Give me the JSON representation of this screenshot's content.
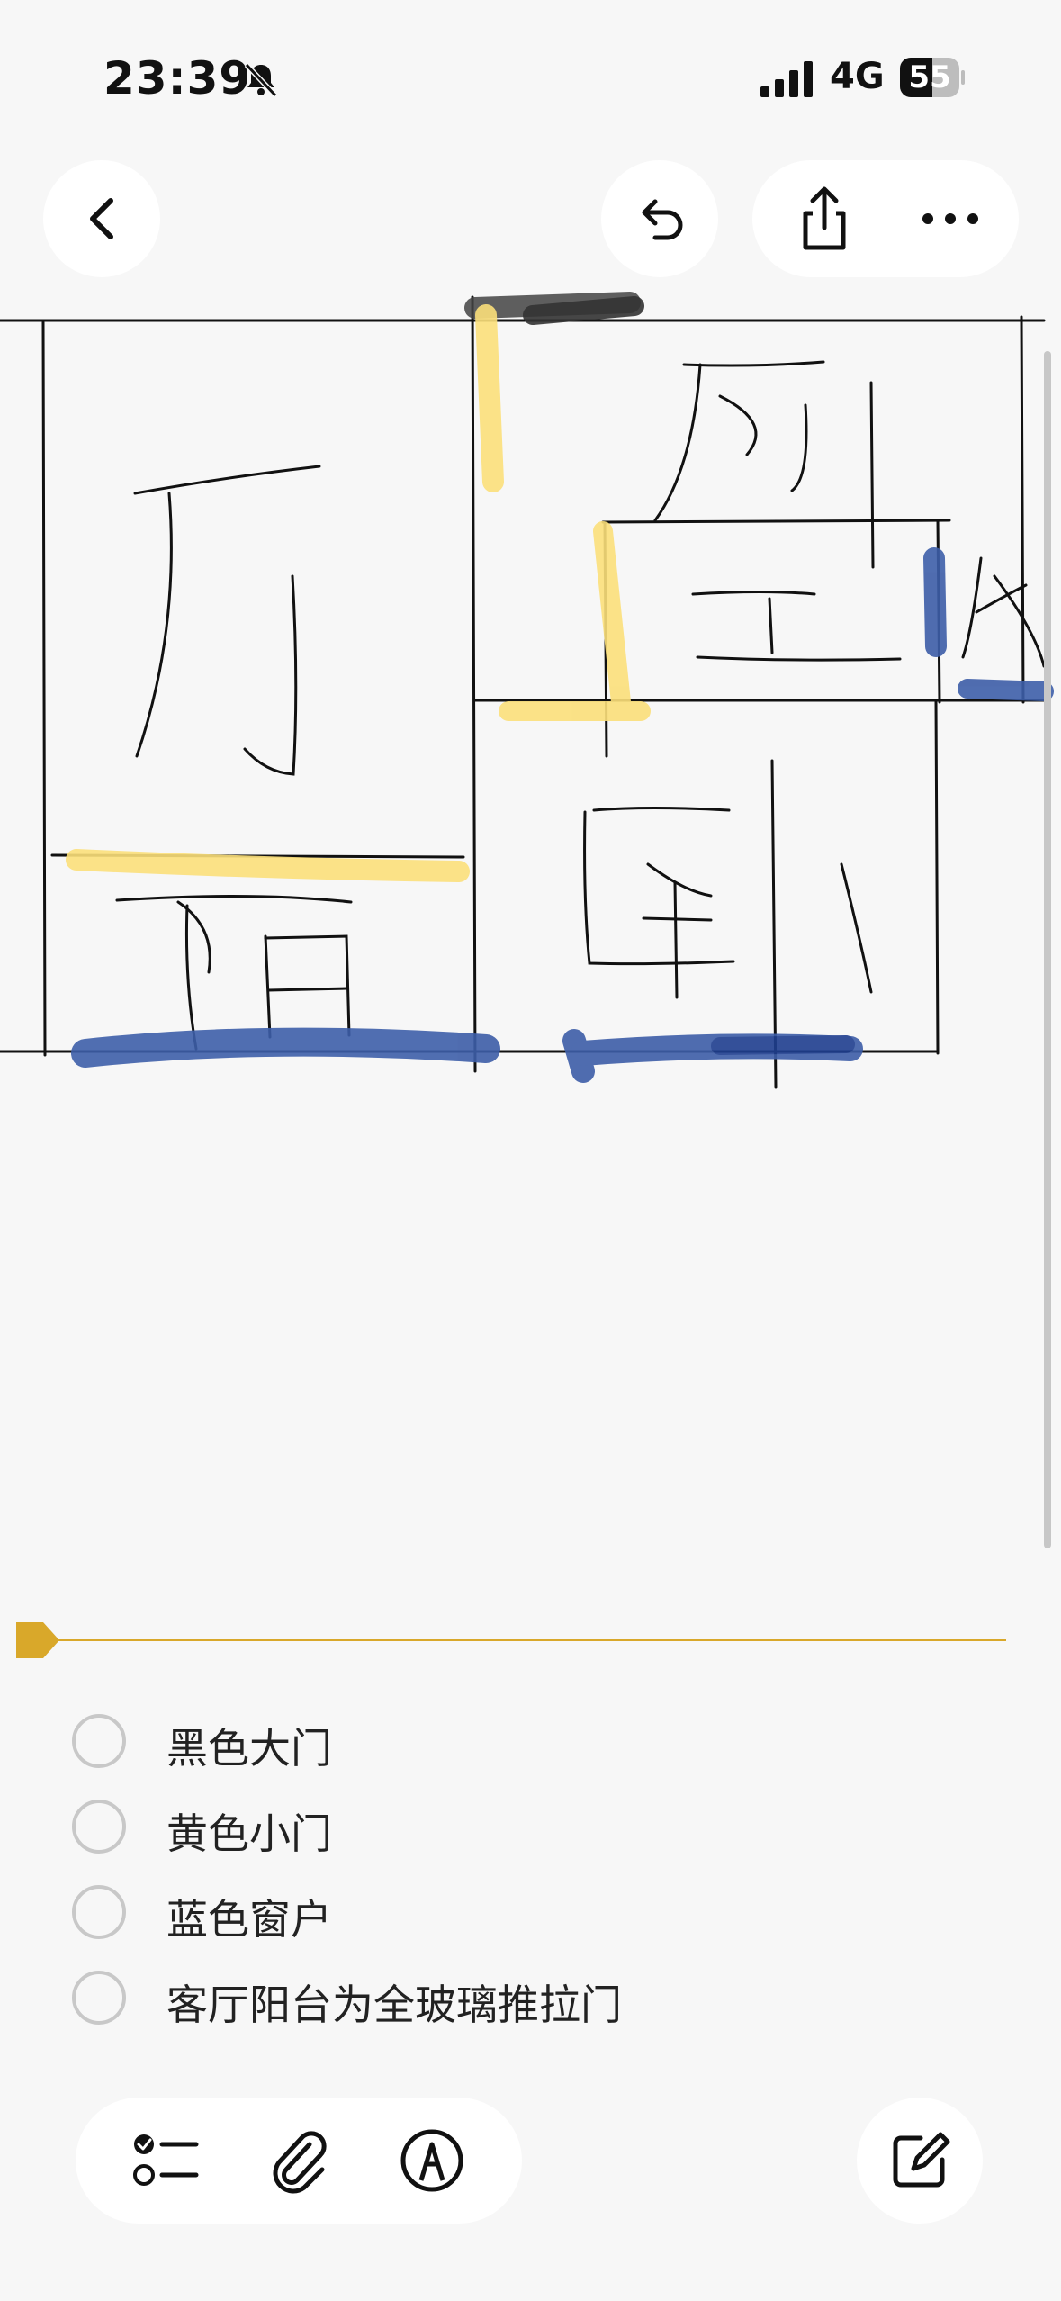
{
  "status": {
    "time": "23:39",
    "network": "4G",
    "battery_level": "55",
    "battery_fraction": 0.55,
    "icons": [
      "bell-slash-icon",
      "signal-icon",
      "battery-icon"
    ]
  },
  "toolbar": {
    "icons": [
      "chevron-left-icon",
      "undo-icon",
      "share-icon",
      "ellipsis-icon"
    ]
  },
  "colors": {
    "accent": "#d9a82a",
    "yellow_door": "#fbdf7a",
    "blue_window": "#3d5ea8",
    "black_door": "#444444"
  },
  "checklist": [
    {
      "label": "黑色大门",
      "checked": false
    },
    {
      "label": "黄色小门",
      "checked": false
    },
    {
      "label": "蓝色窗户",
      "checked": false
    },
    {
      "label": "客厅阳台为全玻璃推拉门",
      "checked": false
    }
  ],
  "bottom_toolbar": {
    "icons": [
      "checklist-icon",
      "paperclip-icon",
      "markup-pen-icon",
      "compose-icon"
    ]
  }
}
